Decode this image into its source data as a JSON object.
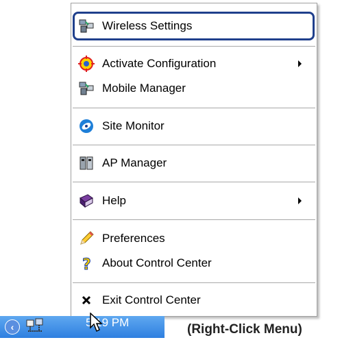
{
  "menu": {
    "items": [
      {
        "label": "Wireless Settings",
        "icon": "network-computer-icon",
        "has_submenu": false,
        "selected": true
      },
      {
        "label": "Activate Configuration",
        "icon": "target-icon",
        "has_submenu": true
      },
      {
        "label": "Mobile Manager",
        "icon": "network-computer-icon",
        "has_submenu": false
      },
      {
        "label": "Site Monitor",
        "icon": "satellite-dish-icon",
        "has_submenu": false
      },
      {
        "label": "AP Manager",
        "icon": "access-point-icon",
        "has_submenu": false
      },
      {
        "label": "Help",
        "icon": "help-book-icon",
        "has_submenu": true
      },
      {
        "label": "Preferences",
        "icon": "pencil-icon",
        "has_submenu": false
      },
      {
        "label": "About Control Center",
        "icon": "question-mark-icon",
        "has_submenu": false
      },
      {
        "label": "Exit Control Center",
        "icon": "close-x-icon",
        "has_submenu": false
      }
    ]
  },
  "taskbar": {
    "clock": "5:19 PM",
    "tray_icon": "network-tray-icon",
    "expand_icon": "chevron-left-icon"
  },
  "caption": "(Right-Click Menu)",
  "colors": {
    "selection_border": "#1f3f8c",
    "taskbar": "#3a8ae6"
  }
}
